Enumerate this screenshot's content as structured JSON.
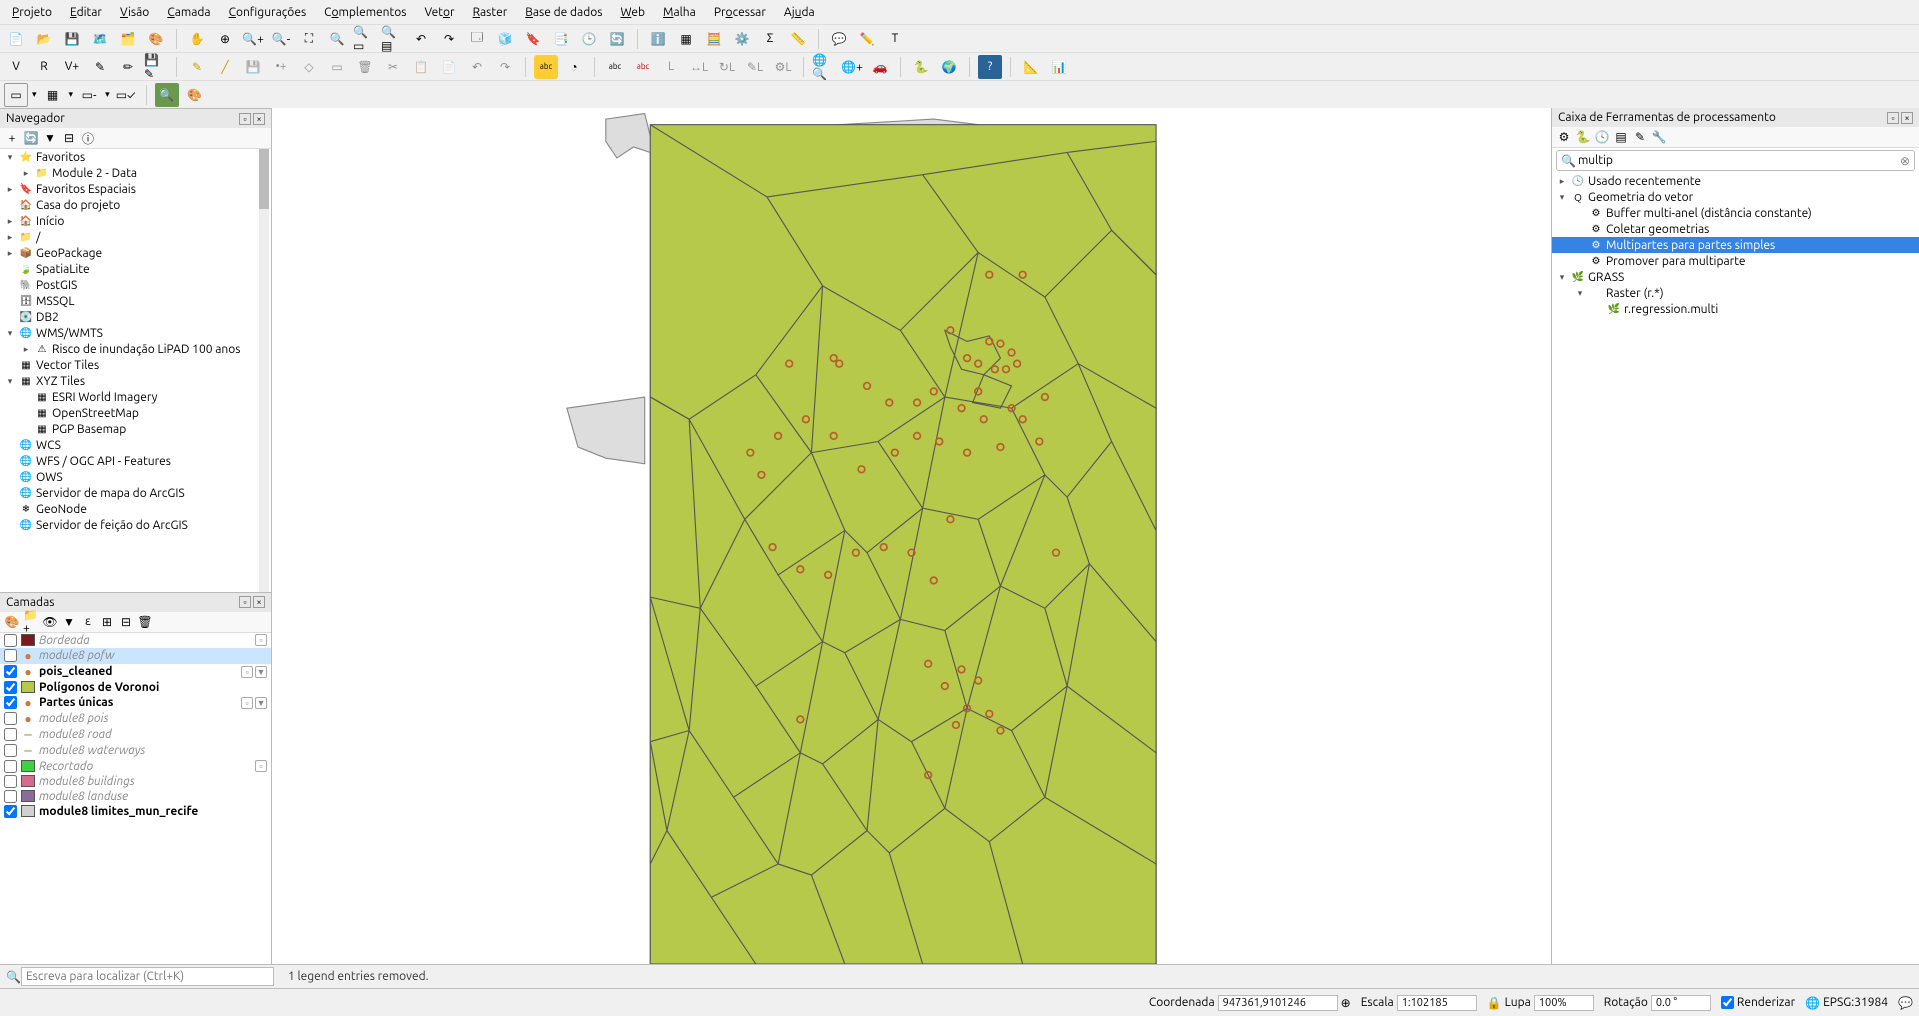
{
  "menu": [
    "Projeto",
    "Editar",
    "Visão",
    "Camada",
    "Configurações",
    "Complementos",
    "Vetor",
    "Raster",
    "Base de dados",
    "Web",
    "Malha",
    "Processar",
    "Ajuda"
  ],
  "menu_mnemonic_idx": [
    0,
    0,
    0,
    0,
    0,
    1,
    3,
    0,
    0,
    0,
    0,
    2,
    2
  ],
  "browser": {
    "title": "Navegador",
    "items": [
      {
        "d": 0,
        "a": "v",
        "i": "star",
        "t": "Favoritos"
      },
      {
        "d": 1,
        "a": ">",
        "i": "folder",
        "t": "Module 2 - Data"
      },
      {
        "d": 0,
        "a": ">",
        "i": "spat",
        "t": "Favoritos Espaciais"
      },
      {
        "d": 0,
        "a": "",
        "i": "home",
        "t": "Casa do projeto"
      },
      {
        "d": 0,
        "a": ">",
        "i": "home",
        "t": "Início"
      },
      {
        "d": 0,
        "a": ">",
        "i": "folder",
        "t": "/"
      },
      {
        "d": 0,
        "a": ">",
        "i": "gpkg",
        "t": "GeoPackage"
      },
      {
        "d": 0,
        "a": "",
        "i": "sl",
        "t": "SpatiaLite"
      },
      {
        "d": 0,
        "a": "",
        "i": "pg",
        "t": "PostGIS"
      },
      {
        "d": 0,
        "a": "",
        "i": "ms",
        "t": "MSSQL"
      },
      {
        "d": 0,
        "a": "",
        "i": "db2",
        "t": "DB2"
      },
      {
        "d": 0,
        "a": "v",
        "i": "wms",
        "t": "WMS/WMTS"
      },
      {
        "d": 1,
        "a": ">",
        "i": "risk",
        "t": "Risco de inundação LiPAD 100 anos"
      },
      {
        "d": 0,
        "a": "",
        "i": "vt",
        "t": "Vector Tiles"
      },
      {
        "d": 0,
        "a": "v",
        "i": "xyz",
        "t": "XYZ Tiles"
      },
      {
        "d": 1,
        "a": "",
        "i": "grid",
        "t": "ESRI World Imagery"
      },
      {
        "d": 1,
        "a": "",
        "i": "grid",
        "t": "OpenStreetMap"
      },
      {
        "d": 1,
        "a": "",
        "i": "grid",
        "t": "PGP Basemap"
      },
      {
        "d": 0,
        "a": "",
        "i": "wms",
        "t": "WCS"
      },
      {
        "d": 0,
        "a": "",
        "i": "wfs",
        "t": "WFS / OGC API - Features"
      },
      {
        "d": 0,
        "a": "",
        "i": "ows",
        "t": "OWS"
      },
      {
        "d": 0,
        "a": "",
        "i": "arc",
        "t": "Servidor de mapa do ArcGIS"
      },
      {
        "d": 0,
        "a": "",
        "i": "gn",
        "t": "GeoNode"
      },
      {
        "d": 0,
        "a": "",
        "i": "arc",
        "t": "Servidor de feição do ArcGIS"
      }
    ]
  },
  "layers": {
    "title": "Camadas",
    "items": [
      {
        "c": false,
        "sw": "#7a1b1b",
        "t": "Bordeada",
        "dim": true,
        "suf": "m"
      },
      {
        "c": false,
        "pt": "#cc7a3a",
        "t": "module8 pofw",
        "dim": true,
        "sel": true
      },
      {
        "c": true,
        "pt": "#cc7a3a",
        "t": "pois_cleaned",
        "bold": true,
        "suf": "mf"
      },
      {
        "c": true,
        "sw": "#b6c94a",
        "t": "Polígonos de Voronoi",
        "bold": true
      },
      {
        "c": true,
        "pt": "#cc7a3a",
        "t": "Partes únicas",
        "bold": true,
        "suf": "mf"
      },
      {
        "c": false,
        "pt": "#cc7a3a",
        "t": "module8 pois",
        "dim": true
      },
      {
        "c": false,
        "ln": "#c9c4a0",
        "t": "module8 road",
        "dim": true
      },
      {
        "c": false,
        "ln": "#c9c4a0",
        "t": "module8 waterways",
        "dim": true
      },
      {
        "c": false,
        "sw": "#3fd13f",
        "t": "Recortado",
        "dim": true,
        "suf": "m"
      },
      {
        "c": false,
        "sw": "#d66b8f",
        "t": "module8 buildings",
        "dim": true
      },
      {
        "c": false,
        "sw": "#8a6b9c",
        "t": "module8 landuse",
        "dim": true
      },
      {
        "c": true,
        "sw": "#d0d0d0",
        "t": "module8 limites_mun_recife",
        "bold": true
      }
    ]
  },
  "processing": {
    "title": "Caixa de Ferramentas de processamento",
    "search": "multip",
    "tree": [
      {
        "d": 0,
        "a": ">",
        "i": "clock",
        "t": "Usado recentemente"
      },
      {
        "d": 0,
        "a": "v",
        "i": "q",
        "t": "Geometria do vetor"
      },
      {
        "d": 1,
        "a": "",
        "i": "alg",
        "t": "Buffer multi-anel (distância constante)"
      },
      {
        "d": 1,
        "a": "",
        "i": "alg",
        "t": "Coletar geometrias"
      },
      {
        "d": 1,
        "a": "",
        "i": "alg",
        "t": "Multipartes para partes simples",
        "sel": true
      },
      {
        "d": 1,
        "a": "",
        "i": "alg",
        "t": "Promover para multiparte"
      },
      {
        "d": 0,
        "a": "v",
        "i": "grass",
        "t": "GRASS"
      },
      {
        "d": 1,
        "a": "v",
        "i": "",
        "t": "Raster (r.*)"
      },
      {
        "d": 2,
        "a": "",
        "i": "grass",
        "t": "r.regression.multi"
      }
    ]
  },
  "status": {
    "locator_ph": "Escreva para localizar (Ctrl+K)",
    "message": "1 legend entries removed.",
    "coord_label": "Coordenada",
    "coord_value": "947361,9101246",
    "scale_label": "Escala",
    "scale_value": "1:102185",
    "lupa_label": "Lupa",
    "lupa_value": "100%",
    "rot_label": "Rotação",
    "rot_value": "0.0 °",
    "render_label": "Renderizar",
    "crs": "EPSG:31984"
  }
}
